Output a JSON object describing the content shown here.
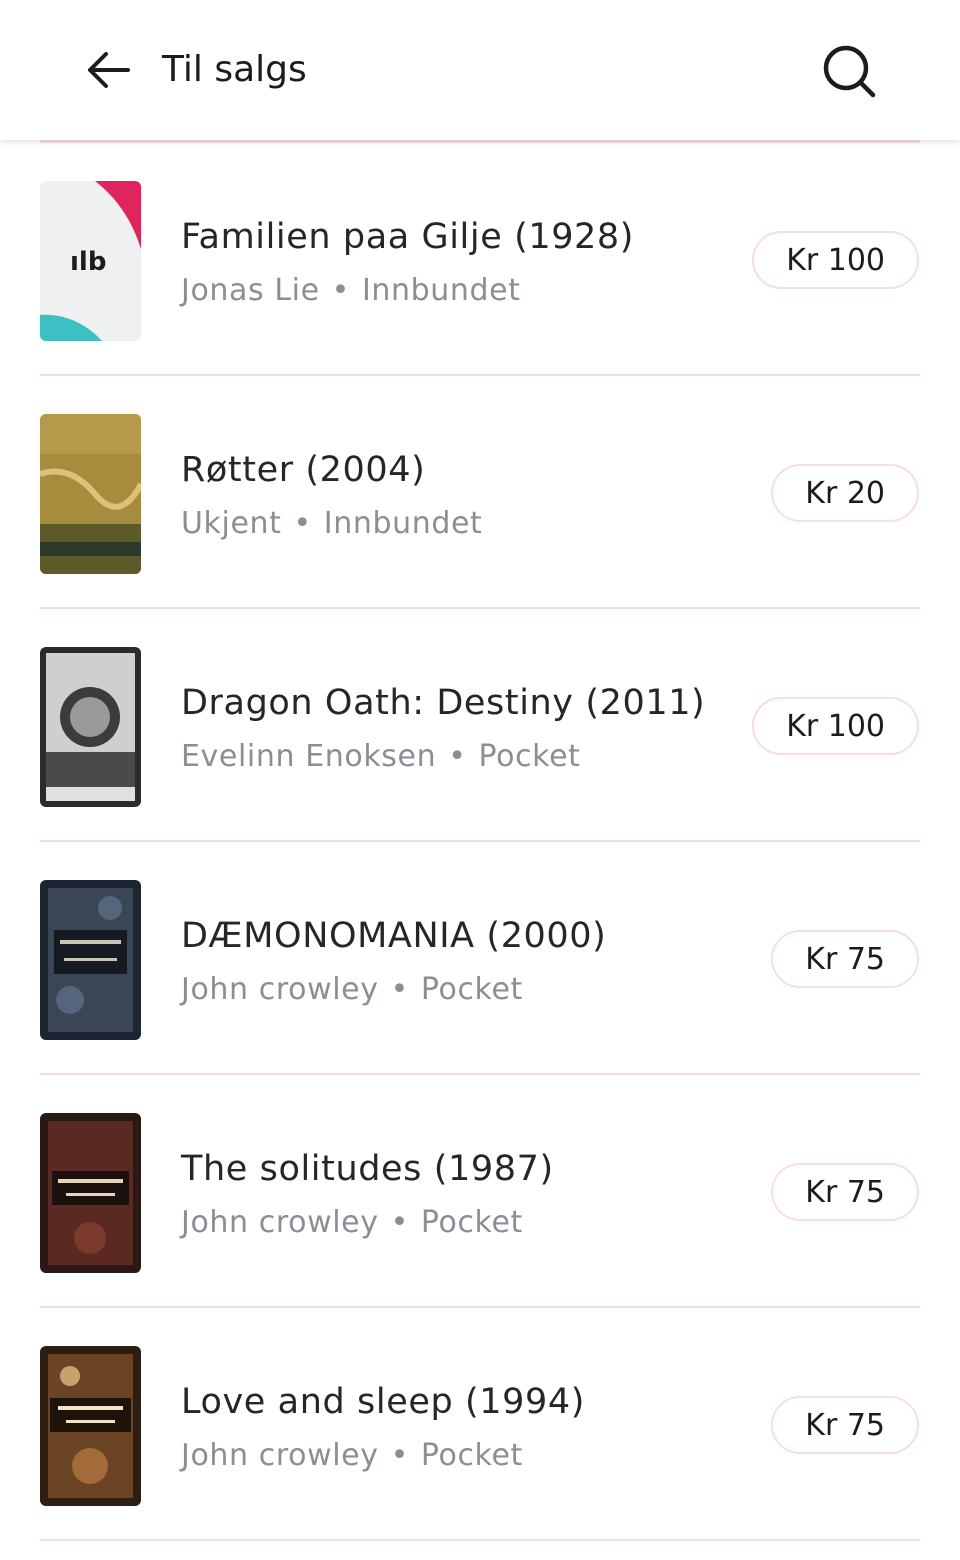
{
  "header": {
    "title": "Til salgs",
    "back_icon": "arrow-left-icon",
    "search_icon": "search-icon"
  },
  "books": [
    {
      "title": "Familien paa Gilje  (1928)",
      "author": "Jonas Lie",
      "separator": "•",
      "format": "Innbundet",
      "price": "Kr 100",
      "cover": "placeholder-logo"
    },
    {
      "title": "Røtter (2004)",
      "author": "Ukjent",
      "separator": "•",
      "format": "Innbundet",
      "price": "Kr 20",
      "cover": "photo"
    },
    {
      "title": "Dragon Oath: Destiny (2011)",
      "author": "Evelinn Enoksen",
      "separator": "•",
      "format": "Pocket",
      "price": "Kr 100",
      "cover": "photo"
    },
    {
      "title": "DÆMONOMANIA (2000)",
      "author": "John crowley",
      "separator": "•",
      "format": "Pocket",
      "price": "Kr 75",
      "cover": "photo"
    },
    {
      "title": "The solitudes  (1987)",
      "author": "John crowley",
      "separator": "•",
      "format": "Pocket",
      "price": "Kr 75",
      "cover": "photo"
    },
    {
      "title": "Love and sleep (1994)",
      "author": "John crowley",
      "separator": "•",
      "format": "Pocket",
      "price": "Kr 75",
      "cover": "photo"
    }
  ],
  "cover_logo_text": "ılb",
  "colors": {
    "divider": "#f3dbe3",
    "price_border": "#f6dde6",
    "meta_text": "#8a8f96",
    "logo_accent": "#e0245e",
    "logo_teal": "#3cc0c4"
  }
}
